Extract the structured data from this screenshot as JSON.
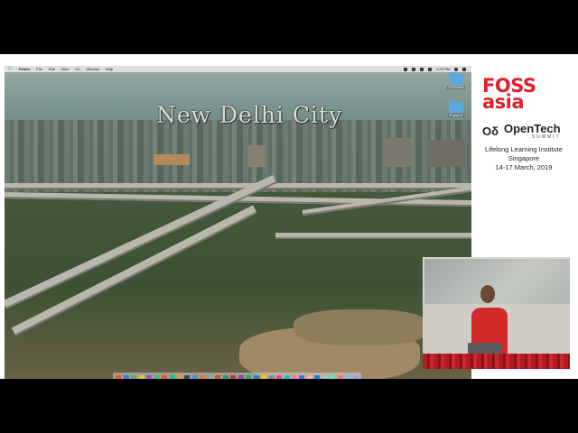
{
  "screen": {
    "menubar": {
      "apple_icon": "apple-icon",
      "items": [
        "Finder",
        "File",
        "Edit",
        "View",
        "Go",
        "Window",
        "Help"
      ],
      "clock": "1:23 PM"
    },
    "wallpaper_title": "New Delhi City",
    "desktop_icons": [
      {
        "label": "FOSSASIA",
        "icon": "folder-icon"
      },
      {
        "label": "Singapore",
        "icon": "folder-icon"
      }
    ],
    "dock_colors": [
      "#e85a2a",
      "#3d7be0",
      "#57b847",
      "#f0c419",
      "#9b59b6",
      "#2ecc71",
      "#e74c3c",
      "#1abc9c",
      "#f39c12",
      "#34495e",
      "#3498db",
      "#e67e22",
      "#95a5a6",
      "#d35400",
      "#16a085",
      "#c0392b",
      "#8e44ad",
      "#27ae60",
      "#2980b9",
      "#f1c40f",
      "#7f8c8d",
      "#e84393",
      "#00cec9",
      "#fd79a8",
      "#6c5ce7",
      "#fab1a0",
      "#0984e3",
      "#b2bec3",
      "#55efc4",
      "#ff7675",
      "#74b9ff",
      "#a29bfe"
    ]
  },
  "branding": {
    "foss_line1": "FOSS",
    "foss_line2": "asia",
    "foss_color": "#e0202b",
    "opentech_glyph": "Oδ",
    "opentech_word": "OpenTech",
    "summit_word": "SUMMIT",
    "venue": "Lifelong Learning Institute",
    "city": "Singapore",
    "dates": "14-17 March, 2019"
  }
}
